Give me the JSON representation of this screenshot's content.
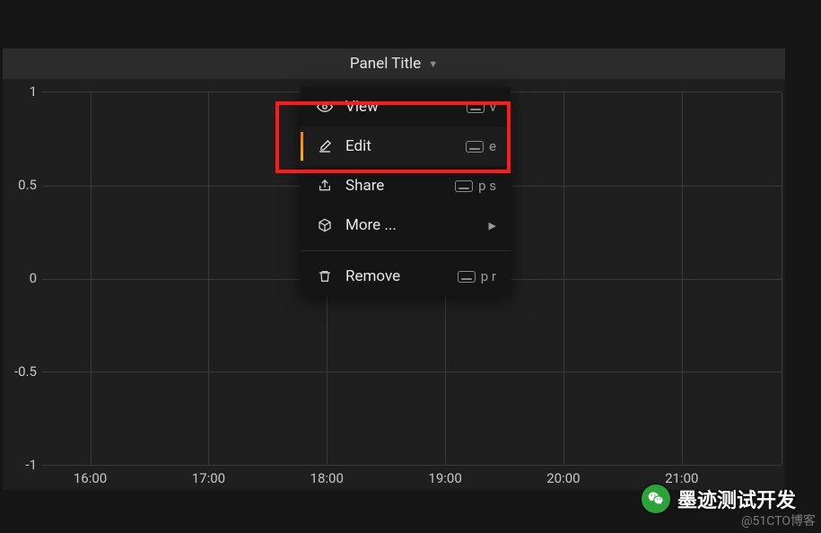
{
  "panel": {
    "title": "Panel Title"
  },
  "menu": {
    "view": {
      "label": "View",
      "shortcut": "v"
    },
    "edit": {
      "label": "Edit",
      "shortcut": "e"
    },
    "share": {
      "label": "Share",
      "shortcut": "p s"
    },
    "more": {
      "label": "More ..."
    },
    "remove": {
      "label": "Remove",
      "shortcut": "p r"
    }
  },
  "chart_data": {
    "type": "line",
    "title": "Panel Title",
    "x": [
      "16:00",
      "17:00",
      "18:00",
      "19:00",
      "20:00",
      "21:00"
    ],
    "series": [],
    "xlabel": "",
    "ylabel": "",
    "ylim": [
      -1.0,
      1.0
    ],
    "yticks": [
      -1.0,
      -0.5,
      0,
      0.5,
      1.0
    ],
    "grid": true
  },
  "watermark": {
    "chat": "墨迹测试开发",
    "blog": "@51CTO博客"
  }
}
